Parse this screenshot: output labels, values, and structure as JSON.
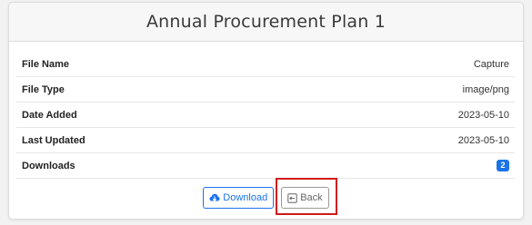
{
  "card": {
    "title": "Annual Procurement Plan 1"
  },
  "details": [
    {
      "label": "File Name",
      "value": "Capture"
    },
    {
      "label": "File Type",
      "value": "image/png"
    },
    {
      "label": "Date Added",
      "value": "2023-05-10"
    },
    {
      "label": "Last Updated",
      "value": "2023-05-10"
    },
    {
      "label": "Downloads",
      "badge": "2"
    }
  ],
  "actions": {
    "download_label": "Download",
    "back_label": "Back"
  },
  "colors": {
    "primary": "#1a73e8",
    "highlight": "#d11a1a"
  },
  "icons": {
    "download": "cloud-download-icon",
    "back": "box-arrow-left-icon"
  }
}
